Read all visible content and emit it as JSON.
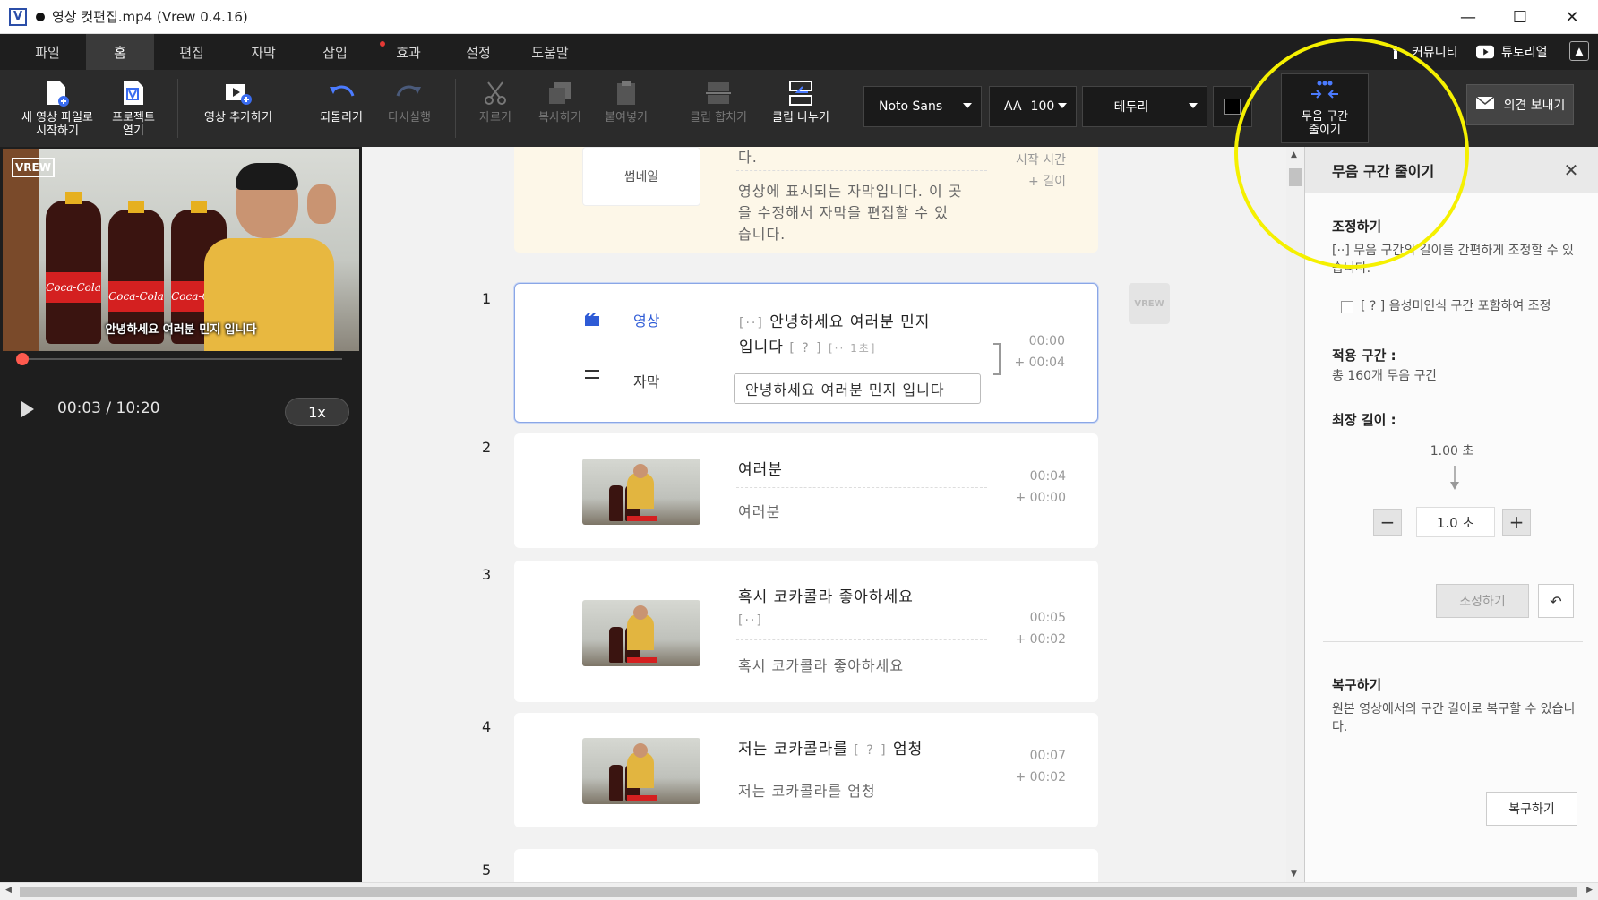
{
  "window": {
    "app_logo": "V",
    "title": "영상 컷편집.mp4 (Vrew 0.4.16)",
    "minimize": "—",
    "maximize": "☐",
    "close": "✕"
  },
  "menu": {
    "items": [
      "파일",
      "홈",
      "편집",
      "자막",
      "삽입",
      "효과",
      "설정",
      "도움말"
    ],
    "active": "홈",
    "community": "커뮤니티",
    "tutorial": "튜토리얼"
  },
  "toolbar": {
    "new_video": [
      "새 영상 파일로",
      "시작하기"
    ],
    "open_project": [
      "프로젝트",
      "열기"
    ],
    "add_video": "영상 추가하기",
    "undo": "되돌리기",
    "redo": "다시실행",
    "cut": "자르기",
    "copy": "복사하기",
    "paste": "붙여넣기",
    "merge_clip": "클립 합치기",
    "split_clip": "클립 나누기",
    "font": "Noto Sans",
    "font_size_prefix": "AA",
    "font_size": "100",
    "border": "테두리",
    "text_color": "#000000",
    "silence": [
      "무음 구간",
      "줄이기"
    ],
    "feedback": "의견 보내기"
  },
  "player": {
    "watermark": "VREW",
    "subtitle": "안녕하세요 여러분 민지 입니다",
    "time": "00:03 / 10:20",
    "speed": "1x",
    "progress": 0.005
  },
  "editor": {
    "intro": {
      "thumb_label": "썸네일",
      "line1": "다.",
      "line2": "영상에 표시되는 자막입니다. 이 곳",
      "line3": "을 수정해서 자막을 편집할 수 있",
      "line4": "습니다.",
      "start_time_label": "시작 시간",
      "length_label": "+ 길이"
    },
    "clips": [
      {
        "num": "1",
        "video_label": "영상",
        "subtitle_label": "자막",
        "tag": "[··]",
        "text_line1": "안녕하세요  여러분  민지",
        "text_line2": "입니다",
        "tag2": "[ ? ]",
        "tag3": "[·· 1초]",
        "subtitle": "안녕하세요 여러분 민지 입니다",
        "start": "00:00",
        "length": "+ 00:04"
      },
      {
        "num": "2",
        "text": "여러분",
        "subtitle": "여러분",
        "start": "00:04",
        "length": "+ 00:00"
      },
      {
        "num": "3",
        "text": "혹시  코카콜라  좋아하세요",
        "tag": "[··]",
        "subtitle": "혹시 코카콜라 좋아하세요",
        "start": "00:05",
        "length": "+ 00:02"
      },
      {
        "num": "4",
        "text": "저는  코카콜라를",
        "tag": "[ ? ]",
        "text2": "엄청",
        "subtitle": "저는 코카콜라를 엄청",
        "start": "00:07",
        "length": "+ 00:02"
      },
      {
        "num": "5"
      }
    ],
    "side_icon": "VREW"
  },
  "panel": {
    "title": "무음 구간 줄이기",
    "adjust_heading": "조정하기",
    "adjust_desc": "[··] 무음 구간의 길이를 간편하게 조정할 수 있습니다.",
    "include_unrecognized": "[ ? ] 음성미인식 구간 포함하여 조정",
    "apply_range_heading": "적용 구간 :",
    "apply_range_value": "총 160개 무음 구간",
    "max_length_heading": "최장 길이 :",
    "from_value": "1.00 초",
    "to_value": "1.0 초",
    "minus": "−",
    "plus": "+",
    "apply_button": "조정하기",
    "undo_symbol": "↶",
    "restore_heading": "복구하기",
    "restore_desc": "원본 영상에서의 구간 길이로 복구할 수 있습니다.",
    "restore_button": "복구하기"
  },
  "colors": {
    "accent_blue": "#2e5bd6",
    "highlight": "#f5f000",
    "seek_knob": "#ff5a4e"
  }
}
